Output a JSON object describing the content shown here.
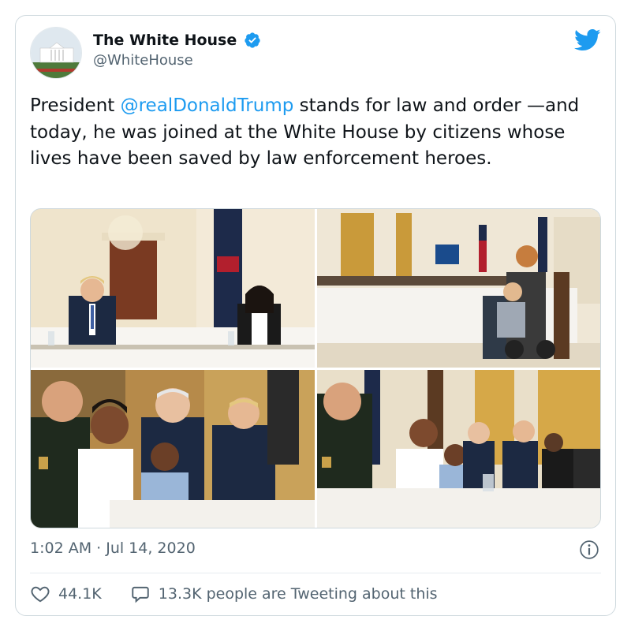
{
  "author": {
    "display_name": "The White House",
    "handle": "@WhiteHouse",
    "verified": true
  },
  "tweet": {
    "text_prefix": "President ",
    "mention": "@realDonaldTrump",
    "text_suffix": " stands for law and order —and today, he was joined at the White House by citizens whose lives have been saved by law enforcement heroes."
  },
  "media": {
    "count": 4
  },
  "meta": {
    "timestamp": "1:02 AM · Jul 14, 2020"
  },
  "actions": {
    "likes": "44.1K",
    "retweets_label": "13.3K people are Tweeting about this"
  },
  "colors": {
    "link": "#1d9bf0",
    "secondary_text": "#536471",
    "border": "#cfd9de"
  },
  "icons": [
    "verified-badge-icon",
    "twitter-bird-icon",
    "info-icon",
    "heart-icon",
    "speech-bubble-icon"
  ]
}
